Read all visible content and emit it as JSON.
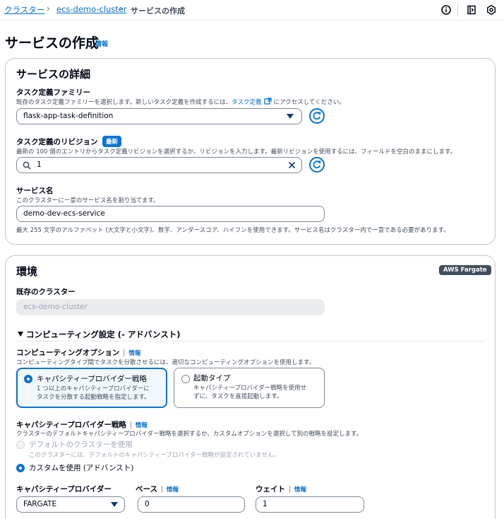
{
  "breadcrumb": {
    "items": [
      "クラスター",
      "ecs-demo-cluster"
    ],
    "current": "サービスの作成"
  },
  "page": {
    "title": "サービスの作成",
    "info": "情報"
  },
  "service_details": {
    "title": "サービスの詳細",
    "task_family": {
      "label": "タスク定義ファミリー",
      "desc_prefix": "既存のタスク定義ファミリーを選択します。新しいタスク定義を作成するには、",
      "desc_link": "タスク定義",
      "desc_suffix": "にアクセスしてください。",
      "value": "flask-app-task-definition"
    },
    "revision": {
      "label": "タスク定義のリビジョン",
      "badge": "最新",
      "desc": "最新の 100 個のエントリからタスク定義リビジョンを選択するか、リビジョンを入力します。最新リビジョンを使用するには、フィールドを空白のままにします。",
      "value": "1"
    },
    "service_name": {
      "label": "サービス名",
      "desc": "このクラスターに一意のサービス名を割り当てます。",
      "value": "demo-dev-ecs-service",
      "constraint": "最大 255 文字のアルファベット (大文字と小文字)、数字、アンダースコア、ハイフンを使用できます。サービス名はクラスター内で一意である必要があります。"
    }
  },
  "environment": {
    "title": "環境",
    "badge": "AWS Fargate",
    "cluster_label": "既存のクラスター",
    "cluster_value": "ecs-demo-cluster",
    "expander": "コンピューティング設定 (- アドバンスト)",
    "compute_option": {
      "label": "コンピューティングオプション",
      "info": "情報",
      "desc": "コンピューティングタイプ間でタスクを分散させるには、適切なコンピューティングオプションを使用します。",
      "tiles": [
        {
          "title": "キャパシティープロバイダー戦略",
          "desc1": "1 つ以上のキャパシティープロバイダーに",
          "desc2": "タスクを分散する起動戦略を指定します。"
        },
        {
          "title": "起動タイプ",
          "desc1": "キャパシティープロバイダー戦略を使用せ",
          "desc2": "ずに、タスクを直接起動します。"
        }
      ]
    },
    "strategy": {
      "label": "キャパシティープロバイダー戦略",
      "info": "情報",
      "desc": "クラスターのデフォルトキャパシティープロバイダー戦略を選択するか、カスタムオプションを選択して別の戦略を設定します。",
      "default_label": "デフォルトのクラスターを使用",
      "default_desc": "このクラスターには、デフォルトのキャパシティープロバイダー戦略が設定されていません。",
      "custom_label": "カスタムを使用 (アドバンスト)"
    },
    "provider": {
      "label": "キャパシティープロバイダー",
      "value": "FARGATE",
      "base_label": "ベース",
      "base_info": "情報",
      "base_value": "0",
      "weight_label": "ウェイト",
      "weight_info": "情報",
      "weight_value": "1"
    }
  },
  "colors": {
    "accent": "#0972d3",
    "text": "#000716",
    "badge_dark": "#414d5c"
  }
}
